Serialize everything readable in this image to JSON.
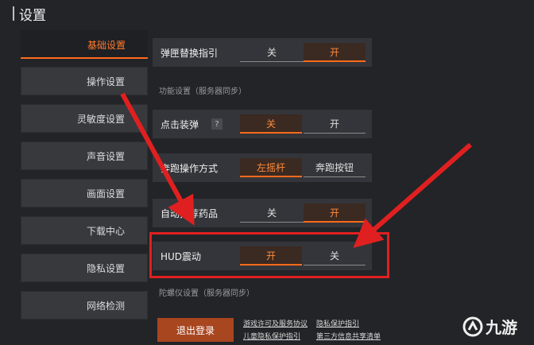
{
  "header": {
    "title": "设置"
  },
  "sidebar": {
    "items": [
      {
        "label": "基础设置",
        "active": true
      },
      {
        "label": "操作设置"
      },
      {
        "label": "灵敏度设置"
      },
      {
        "label": "声音设置"
      },
      {
        "label": "画面设置"
      },
      {
        "label": "下载中心"
      },
      {
        "label": "隐私设置"
      },
      {
        "label": "网络检测"
      }
    ]
  },
  "settings": {
    "crosshair": {
      "label": "弹匣替换指引",
      "off": "关",
      "on": "开",
      "selected": "开"
    },
    "function_section": "功能设置（服务器同步）",
    "tap_load": {
      "label": "点击装弹",
      "help": "?",
      "off": "关",
      "on": "开",
      "selected": "关"
    },
    "sprint_mode": {
      "label": "奔跑操作方式",
      "opt1": "左摇杆",
      "opt2": "奔跑按钮",
      "selected": "左摇杆"
    },
    "recommend_meds": {
      "label": "自动推荐药品",
      "off": "关",
      "on": "开",
      "selected": "开"
    },
    "hud_shake": {
      "label": "HUD震动",
      "on": "开",
      "off": "关",
      "selected": "开"
    },
    "gyro_section": "陀螺仪设置（服务器同步）"
  },
  "footer": {
    "logout_label": "退出登录",
    "links": [
      "游戏许可及服务协议",
      "隐私保护指引",
      "儿童隐私保护指引",
      "第三方信息共享清单"
    ]
  },
  "watermark": {
    "text": "九游"
  },
  "colors": {
    "accent": "#ff6a1a",
    "annotation": "#e02020",
    "logout_bg": "#a8461f"
  }
}
